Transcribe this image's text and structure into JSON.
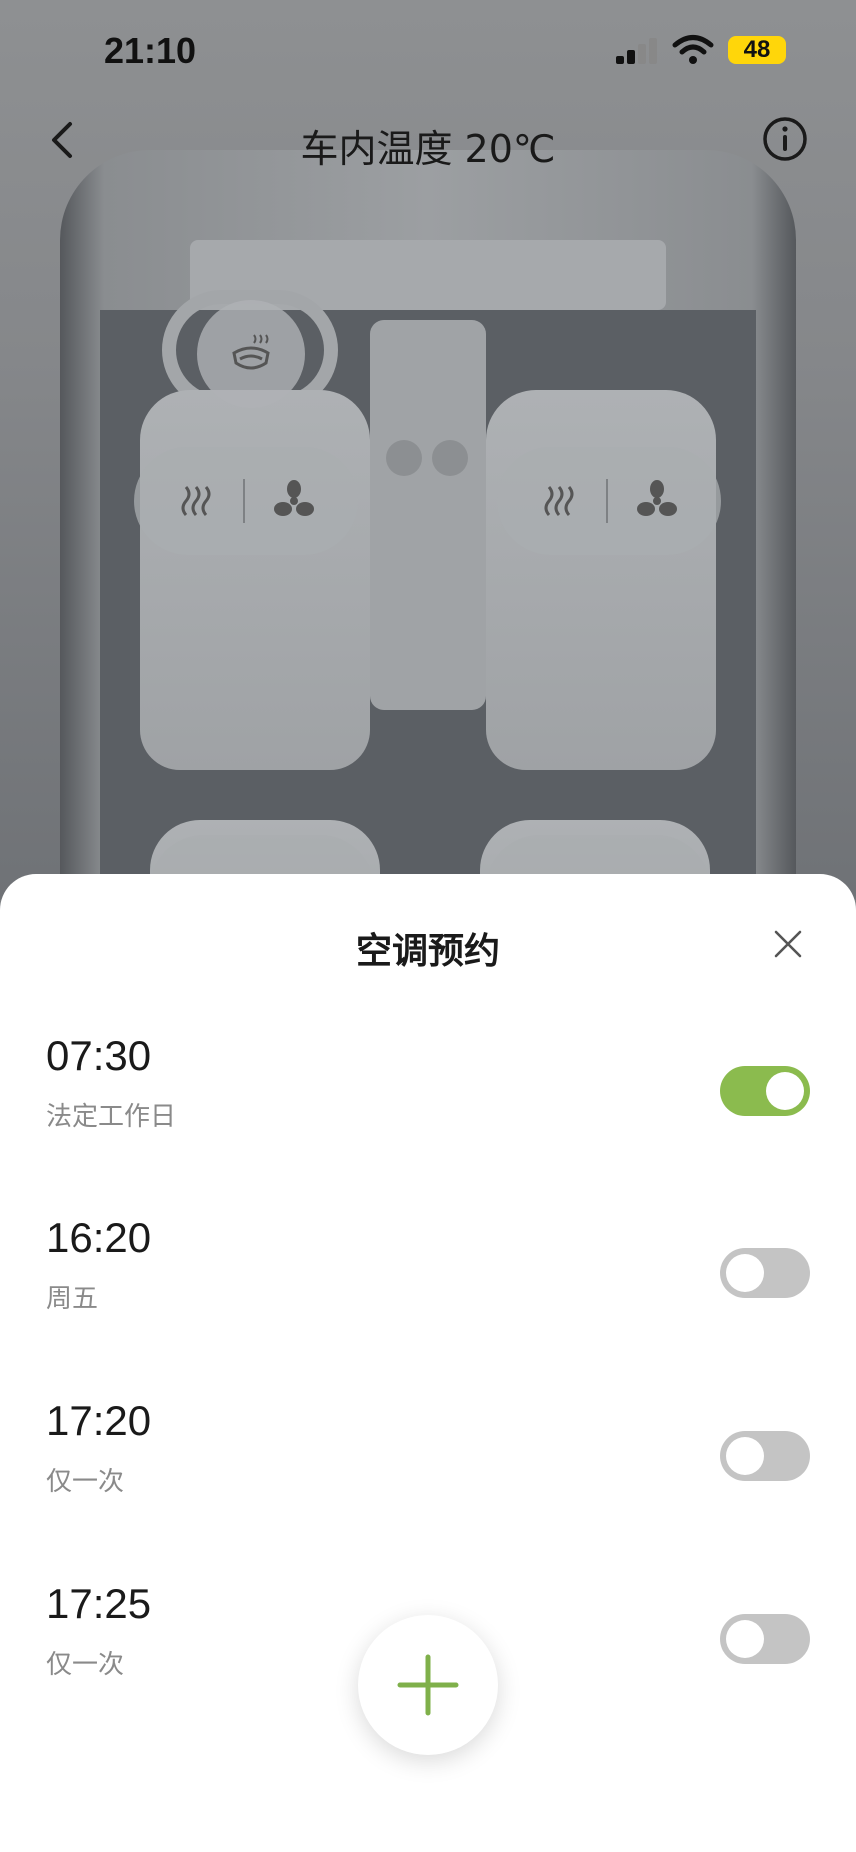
{
  "status_bar": {
    "time": "21:10",
    "battery": "48"
  },
  "nav": {
    "title": "车内温度 20℃"
  },
  "sheet": {
    "title": "空调预约",
    "schedules": [
      {
        "time": "07:30",
        "repeat": "法定工作日",
        "enabled": true
      },
      {
        "time": "16:20",
        "repeat": "周五",
        "enabled": false
      },
      {
        "time": "17:20",
        "repeat": "仅一次",
        "enabled": false
      },
      {
        "time": "17:25",
        "repeat": "仅一次",
        "enabled": false
      }
    ]
  },
  "colors": {
    "toggle_on": "#8bbb4e",
    "toggle_off": "#c4c4c4",
    "plus": "#7fb04a",
    "battery": "#ffd60a"
  },
  "icons": [
    "back-icon",
    "info-icon",
    "steering-heat-icon",
    "seat-heat-icon",
    "seat-fan-icon",
    "close-icon",
    "plus-icon"
  ]
}
